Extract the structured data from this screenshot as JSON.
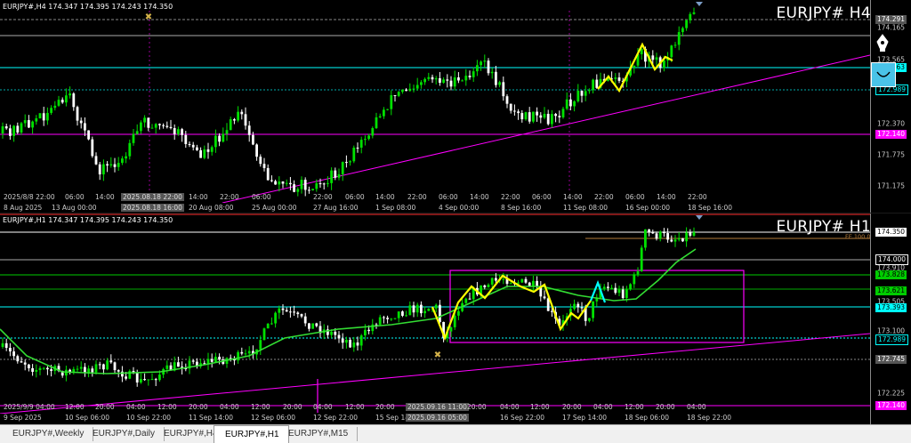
{
  "h4": {
    "info": "EURJPY#,H4  174.347 174.395 174.243 174.350",
    "symbol": "EURJPY#  H4",
    "price_ticks": [
      "174.165",
      "173.565",
      "172.970",
      "172.370",
      "171.775",
      "171.175"
    ],
    "price_labels": [
      {
        "text": "174.291",
        "bg": "#555555",
        "fg": "#ffffff"
      },
      {
        "text": "173.363",
        "bg": "#00ffff",
        "fg": "#000000"
      },
      {
        "text": "172.989",
        "bg": "#000000",
        "fg": "#00ffff"
      },
      {
        "text": "172.140",
        "bg": "#ff00ff",
        "fg": "#ffffff"
      }
    ],
    "time_labels": [
      {
        "text": "2025/8/8 22:00",
        "hl": false
      },
      {
        "text": "06:00",
        "hl": false
      },
      {
        "text": "14:00",
        "hl": false
      },
      {
        "text": "2025.08.18 22:00",
        "hl": true
      },
      {
        "text": "14:00",
        "hl": false
      },
      {
        "text": "22:00",
        "hl": false
      },
      {
        "text": "06:00",
        "hl": false
      },
      {
        "text": "22:00",
        "hl": false
      },
      {
        "text": "06:00",
        "hl": false
      },
      {
        "text": "14:00",
        "hl": false
      },
      {
        "text": "22:00",
        "hl": false
      },
      {
        "text": "06:00",
        "hl": false
      },
      {
        "text": "14:00",
        "hl": false
      },
      {
        "text": "22:00",
        "hl": false
      },
      {
        "text": "06:00",
        "hl": false
      },
      {
        "text": "14:00",
        "hl": false
      },
      {
        "text": "22:00",
        "hl": false
      },
      {
        "text": "06:00",
        "hl": false
      },
      {
        "text": "14:00",
        "hl": false
      },
      {
        "text": "22:00",
        "hl": false
      }
    ],
    "date_labels": [
      {
        "text": "8 Aug 2025",
        "hl": false
      },
      {
        "text": "13 Aug 00:00",
        "hl": false
      },
      {
        "text": "2025.08.18 16:00",
        "hl": true
      },
      {
        "text": "20 Aug 08:00",
        "hl": false
      },
      {
        "text": "25 Aug 00:00",
        "hl": false
      },
      {
        "text": "27 Aug 16:00",
        "hl": false
      },
      {
        "text": "1 Sep 08:00",
        "hl": false
      },
      {
        "text": "4 Sep 00:00",
        "hl": false
      },
      {
        "text": "8 Sep 16:00",
        "hl": false
      },
      {
        "text": "11 Sep 08:00",
        "hl": false
      },
      {
        "text": "16 Sep 00:00",
        "hl": false
      },
      {
        "text": "18 Sep 16:00",
        "hl": false
      }
    ]
  },
  "h1": {
    "info": "EURJPY#,H1  174.347 174.395 174.243 174.350",
    "symbol": "EURJPY#  H1",
    "fe_label": "FE 100.0",
    "price_ticks": [
      "173.910",
      "173.505",
      "173.100",
      "172.225"
    ],
    "price_labels": [
      {
        "text": "174.350",
        "bg": "#ffffff",
        "fg": "#000000"
      },
      {
        "text": "174.000",
        "bg": "#000000",
        "fg": "#ffffff"
      },
      {
        "text": "173.828",
        "bg": "#00cc00",
        "fg": "#000000"
      },
      {
        "text": "173.621",
        "bg": "#00cc00",
        "fg": "#000000"
      },
      {
        "text": "173.393",
        "bg": "#00ffff",
        "fg": "#000000"
      },
      {
        "text": "172.989",
        "bg": "#000000",
        "fg": "#00ffff"
      },
      {
        "text": "172.745",
        "bg": "#555555",
        "fg": "#ffffff"
      },
      {
        "text": "172.140",
        "bg": "#ff00ff",
        "fg": "#ffffff"
      }
    ],
    "date_labels": [
      {
        "text": "9 Sep 2025",
        "hl": false
      },
      {
        "text": "10 Sep 06:00",
        "hl": false
      },
      {
        "text": "10 Sep 22:00",
        "hl": false
      },
      {
        "text": "11 Sep 14:00",
        "hl": false
      },
      {
        "text": "12 Sep 06:00",
        "hl": false
      },
      {
        "text": "12 Sep 22:00",
        "hl": false
      },
      {
        "text": "15 Sep 14:00",
        "hl": false
      },
      {
        "text": "2025.09.16 05:00",
        "hl": true
      },
      {
        "text": "16 Sep 22:00",
        "hl": false
      },
      {
        "text": "17 Sep 14:00",
        "hl": false
      },
      {
        "text": "18 Sep 06:00",
        "hl": false
      },
      {
        "text": "18 Sep 22:00",
        "hl": false
      }
    ],
    "time_labels": [
      {
        "text": "2025/9/9 04:00",
        "hl": false
      },
      {
        "text": "12:00",
        "hl": false
      },
      {
        "text": "20:00",
        "hl": false
      },
      {
        "text": "04:00",
        "hl": false
      },
      {
        "text": "12:00",
        "hl": false
      },
      {
        "text": "20:00",
        "hl": false
      },
      {
        "text": "04:00",
        "hl": false
      },
      {
        "text": "12:00",
        "hl": false
      },
      {
        "text": "20:00",
        "hl": false
      },
      {
        "text": "04:00",
        "hl": false
      },
      {
        "text": "12:00",
        "hl": false
      },
      {
        "text": "20:00",
        "hl": false
      },
      {
        "text": "2025.09.16 11:00",
        "hl": true
      },
      {
        "text": "20:00",
        "hl": false
      },
      {
        "text": "04:00",
        "hl": false
      },
      {
        "text": "12:00",
        "hl": false
      },
      {
        "text": "20:00",
        "hl": false
      },
      {
        "text": "04:00",
        "hl": false
      },
      {
        "text": "12:00",
        "hl": false
      },
      {
        "text": "20:00",
        "hl": false
      },
      {
        "text": "04:00",
        "hl": false
      }
    ]
  },
  "tabs": [
    {
      "label": "EURJPY#,Weekly",
      "active": false
    },
    {
      "label": "EURJPY#,Daily",
      "active": false
    },
    {
      "label": "EURJPY#,H4",
      "active": false
    },
    {
      "label": "EURJPY#,H1",
      "active": true
    },
    {
      "label": "EURJPY#,M15",
      "active": false
    }
  ],
  "colors": {
    "bull": "#00e000",
    "bear": "#ffffff",
    "zigzag": "#ffff00",
    "zigzag_alt": "#00ffff",
    "ma": "#33dd33",
    "trendline": "#ff00ff",
    "range_box": "#ff00ff"
  },
  "icons": [
    "pen-tool-icon",
    "smile-tool-icon",
    "crosshair-marker-icon",
    "shift-triangle-icon"
  ]
}
